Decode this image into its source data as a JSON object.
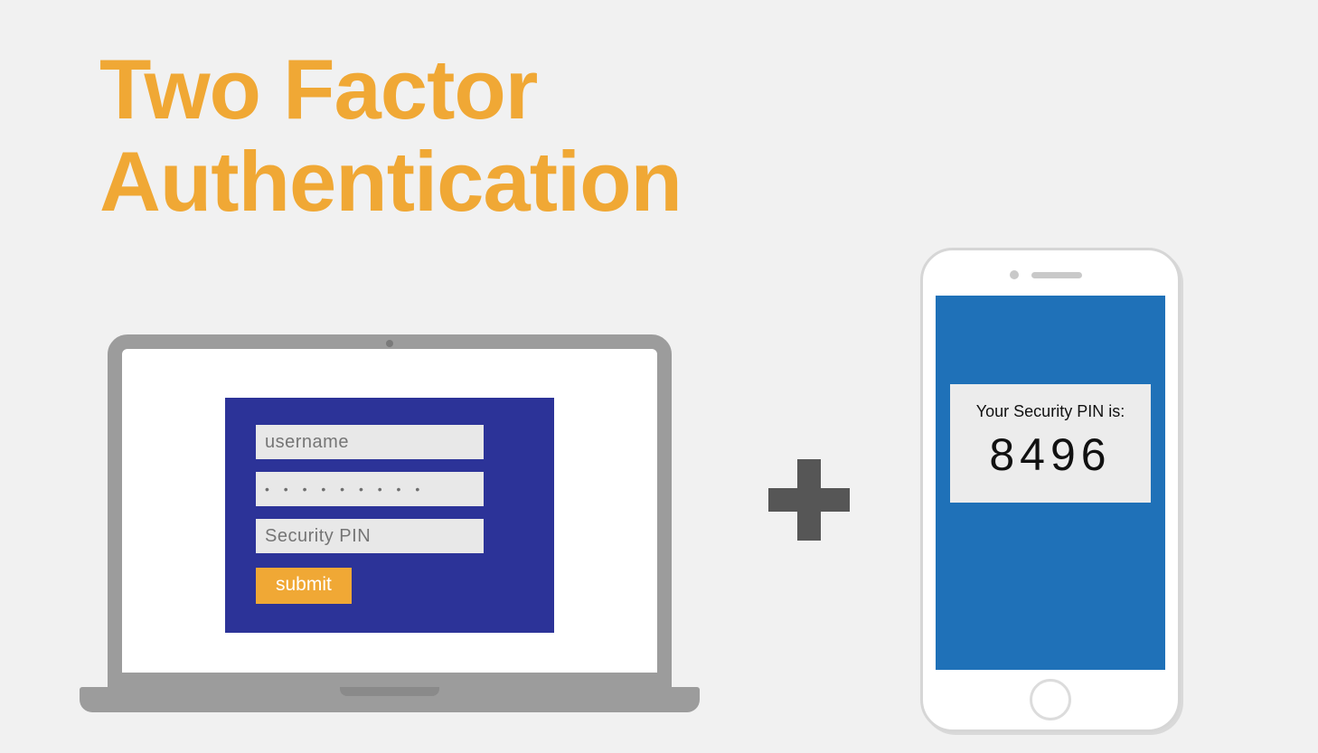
{
  "title_line1": "Two Factor",
  "title_line2": "Authentication",
  "login": {
    "username_placeholder": "username",
    "password_value": "• • • • • • • • •",
    "pin_placeholder": "Security PIN",
    "submit_label": "submit"
  },
  "phone": {
    "pin_label": "Your Security PIN is:",
    "pin_value": "8496"
  },
  "colors": {
    "accent_orange": "#f0a835",
    "panel_blue": "#2c3398",
    "phone_blue": "#1f71b8",
    "plus_grey": "#565656"
  }
}
